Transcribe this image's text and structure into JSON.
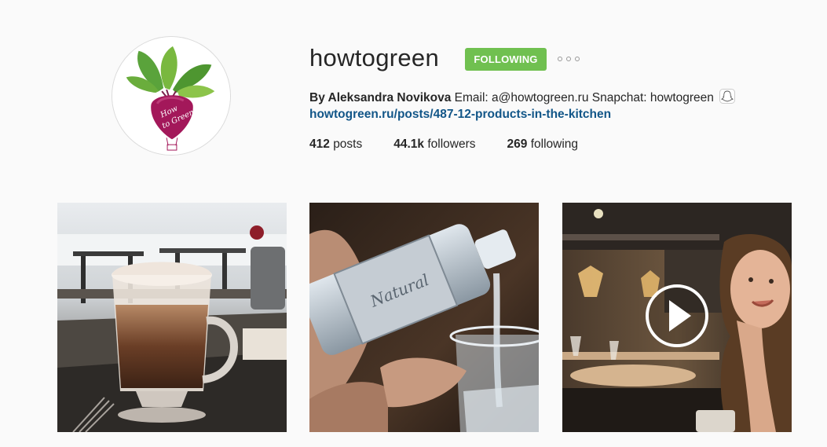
{
  "profile": {
    "username": "howtogreen",
    "follow_button_label": "FOLLOWING",
    "more_options_icon": "more-options-icon",
    "full_name": "By Aleksandra Novikova",
    "bio_text": " Email: a@howtogreen.ru Snapchat: howtogreen ",
    "website": "howtogreen.ru/posts/487-12-products-in-the-kitchen",
    "avatar_icon": "beet-logo-avatar"
  },
  "stats": {
    "posts_count": "412",
    "posts_label": "posts",
    "followers_count": "44.1k",
    "followers_label": "followers",
    "following_count": "269",
    "following_label": "following"
  },
  "posts": [
    {
      "description_icon": "coffee-photo",
      "type": "photo"
    },
    {
      "description_icon": "water-bottle-photo",
      "type": "photo"
    },
    {
      "description_icon": "restaurant-video",
      "type": "video"
    }
  ],
  "colors": {
    "follow_green": "#70c050",
    "link_blue": "#125688",
    "background": "#fafafa"
  }
}
